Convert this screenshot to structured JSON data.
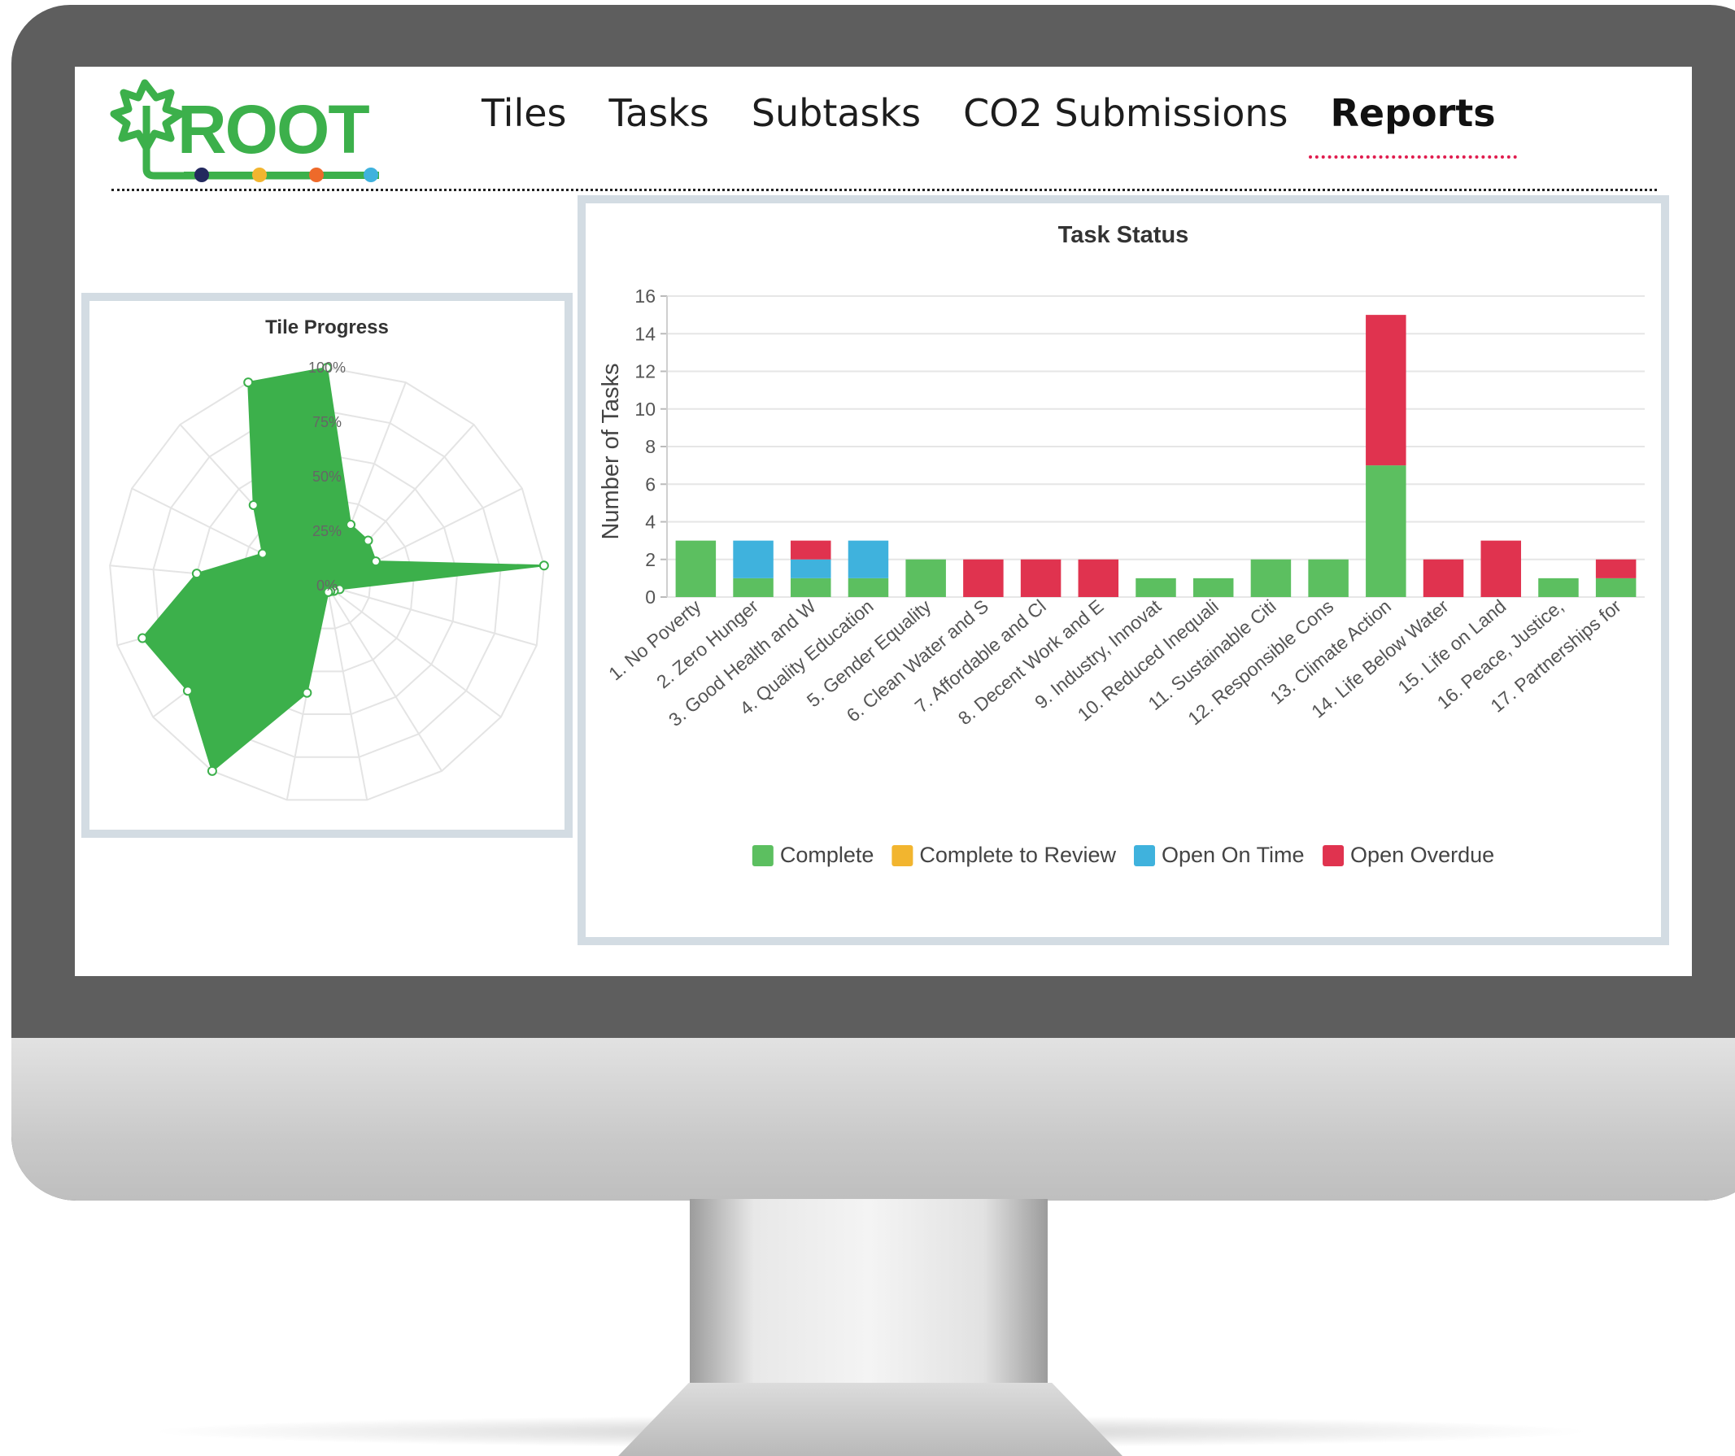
{
  "app": {
    "logo_text": "ROOT"
  },
  "nav": {
    "items": [
      {
        "label": "Tiles",
        "active": false
      },
      {
        "label": "Tasks",
        "active": false
      },
      {
        "label": "Subtasks",
        "active": false
      },
      {
        "label": "CO2 Submissions",
        "active": false
      },
      {
        "label": "Reports",
        "active": true
      }
    ]
  },
  "colors": {
    "complete": "#5cbf60",
    "complete_to_review": "#f2b52f",
    "open_on_time": "#3fb2dd",
    "open_overdue": "#e0334f",
    "radar_fill": "#3cb04b",
    "accent": "#e01c4e"
  },
  "chart_data": [
    {
      "type": "radar",
      "title": "Tile Progress",
      "tick_labels": [
        "0%",
        "25%",
        "50%",
        "75%",
        "100%"
      ],
      "rlim": [
        0,
        100
      ],
      "spokes": 17,
      "values": [
        100,
        30,
        28,
        25,
        100,
        6,
        4,
        3,
        3,
        50,
        100,
        80,
        88,
        60,
        33,
        50,
        100
      ],
      "grid": true
    },
    {
      "type": "bar",
      "stacked": true,
      "title": "Task Status",
      "ylabel": "Number of Tasks",
      "xlabel": "",
      "ylim": [
        0,
        16
      ],
      "yticks": [
        "0",
        "2",
        "4",
        "6",
        "8",
        "10",
        "12",
        "14",
        "16"
      ],
      "categories": [
        "1. No Poverty",
        "2. Zero Hunger",
        "3. Good Health and W",
        "4. Quality Education",
        "5. Gender Equality",
        "6. Clean Water and S",
        "7. Affordable and Cl",
        "8. Decent Work and E",
        "9. Industry, Innovat",
        "10. Reduced Inequali",
        "11. Sustainable Citi",
        "12. Responsible Cons",
        "13. Climate Action",
        "14. Life Below Water",
        "15. Life on Land",
        "16. Peace, Justice,",
        "17. Partnerships for"
      ],
      "series": [
        {
          "name": "Complete",
          "values": [
            3,
            1,
            1,
            1,
            2,
            0,
            0,
            0,
            1,
            1,
            2,
            2,
            7,
            0,
            0,
            1,
            1
          ]
        },
        {
          "name": "Complete to Review",
          "values": [
            0,
            0,
            0,
            0,
            0,
            0,
            0,
            0,
            0,
            0,
            0,
            0,
            0,
            0,
            0,
            0,
            0
          ]
        },
        {
          "name": "Open On Time",
          "values": [
            0,
            2,
            1,
            2,
            0,
            0,
            0,
            0,
            0,
            0,
            0,
            0,
            0,
            0,
            0,
            0,
            0
          ]
        },
        {
          "name": "Open Overdue",
          "values": [
            0,
            0,
            1,
            0,
            0,
            2,
            2,
            2,
            0,
            0,
            0,
            0,
            8,
            2,
            3,
            0,
            1
          ]
        }
      ],
      "legend_position": "bottom",
      "grid": true
    }
  ]
}
